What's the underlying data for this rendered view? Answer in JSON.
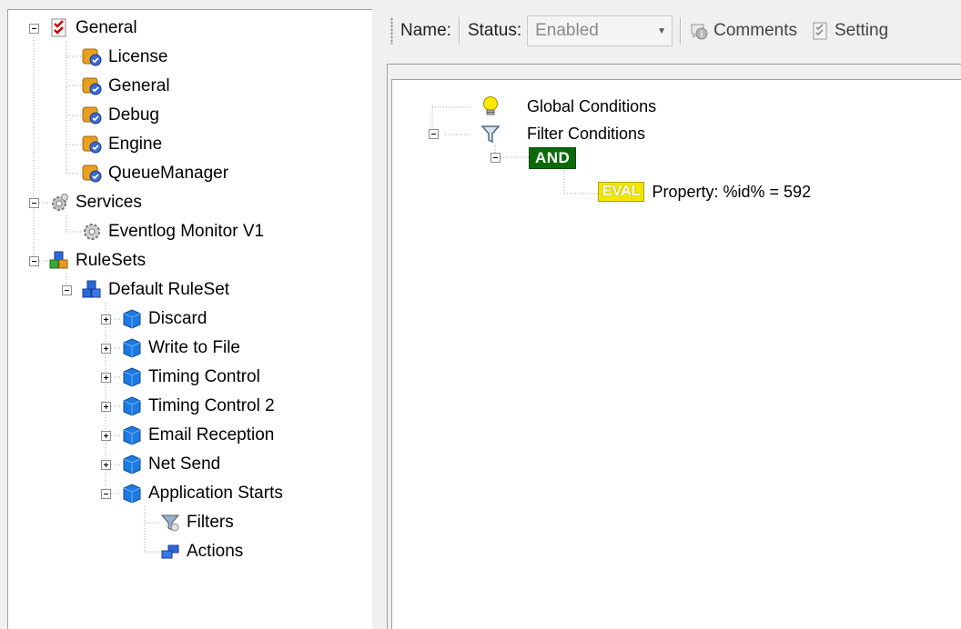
{
  "tree": {
    "general": "General",
    "license": "License",
    "general_child": "General",
    "debug": "Debug",
    "engine": "Engine",
    "queue_manager": "QueueManager",
    "services": "Services",
    "eventlog_monitor": "Eventlog Monitor V1",
    "rulesets": "RuleSets",
    "default_ruleset": "Default RuleSet",
    "rules": [
      "Discard",
      "Write to File",
      "Timing Control",
      "Timing Control 2",
      "Email Reception",
      "Net Send",
      "Application Starts"
    ],
    "filters": "Filters",
    "actions": "Actions"
  },
  "toolbar": {
    "name_label": "Name:",
    "status_label": "Status:",
    "status_value": "Enabled",
    "comments_label": "Comments",
    "settings_label": "Setting"
  },
  "conditions": {
    "global": "Global Conditions",
    "filter": "Filter Conditions",
    "and_label": "AND",
    "eval_label": "EVAL",
    "eval_expression": "Property: %id% = 592"
  },
  "icons": {
    "general": "settings-checklist-icon",
    "config_item": "config-shield-icon",
    "services": "gear-icon",
    "service_item": "gear-icon",
    "rulesets": "ruleset-cubes-icon",
    "ruleset": "ruleset-cubes-icon",
    "rule": "blue-cube-icon",
    "filters": "funnel-icon",
    "actions": "actions-icon",
    "global_conditions": "lightbulb-icon",
    "filter_conditions": "funnel-icon"
  }
}
